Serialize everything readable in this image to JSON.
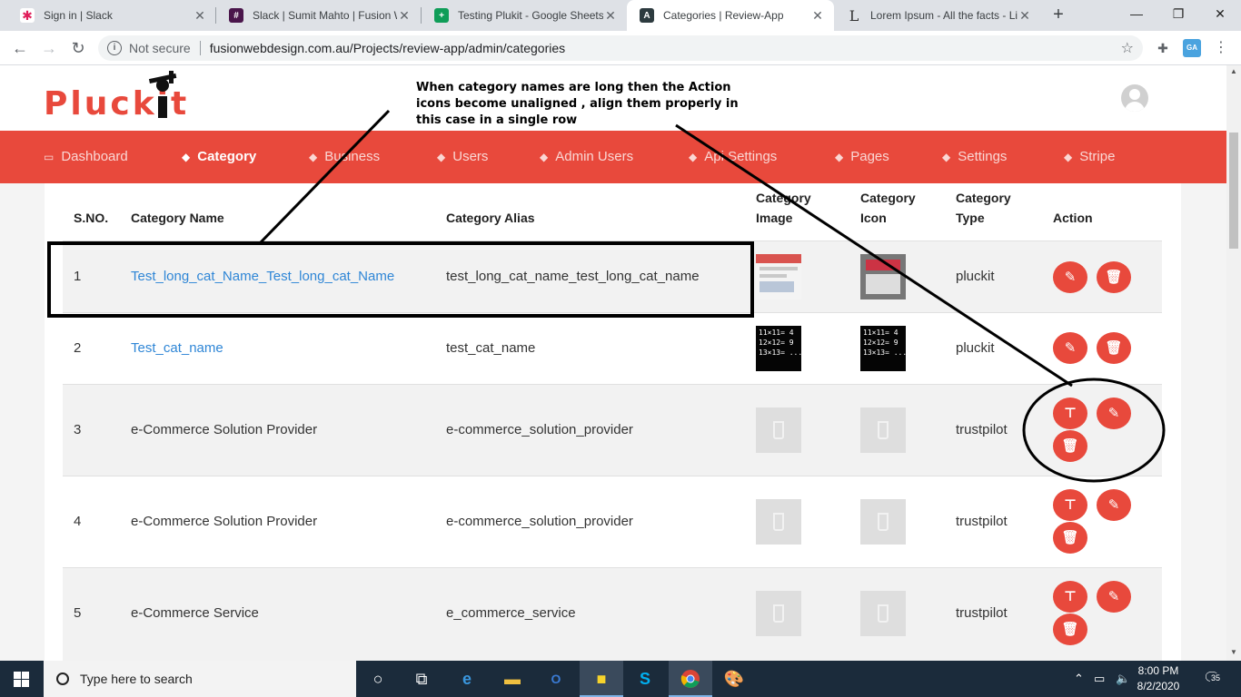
{
  "browser": {
    "tabs": [
      {
        "title": "Sign in | Slack",
        "icon": "slack-icon",
        "active": false
      },
      {
        "title": "Slack | Sumit Mahto | Fusion W",
        "icon": "slack-icon",
        "active": false
      },
      {
        "title": "Testing Plukit - Google Sheets",
        "icon": "google-sheets-icon",
        "active": false
      },
      {
        "title": "Categories | Review-App",
        "icon": "review-app-icon",
        "active": true
      },
      {
        "title": "Lorem Ipsum - All the facts - Li",
        "icon": "lorem-ipsum-icon",
        "active": false
      }
    ],
    "security_label": "Not secure",
    "url": "fusionwebdesign.com.au/Projects/review-app/admin/categories",
    "extension_badge": "GA"
  },
  "header": {
    "logo_text": "Pluckit",
    "annotation": "When category names are long then the Action icons become unaligned , align them properly in this case in a single row"
  },
  "nav": {
    "items": [
      {
        "label": "Dashboard",
        "icon": "monitor-icon",
        "active": false
      },
      {
        "label": "Category",
        "icon": "layers-icon",
        "active": true
      },
      {
        "label": "Business",
        "icon": "layers-icon",
        "active": false
      },
      {
        "label": "Users",
        "icon": "layers-icon",
        "active": false
      },
      {
        "label": "Admin Users",
        "icon": "layers-icon",
        "active": false
      },
      {
        "label": "Api Settings",
        "icon": "layers-icon",
        "active": false
      },
      {
        "label": "Pages",
        "icon": "layers-icon",
        "active": false
      },
      {
        "label": "Settings",
        "icon": "layers-icon",
        "active": false
      },
      {
        "label": "Stripe",
        "icon": "layers-icon",
        "active": false
      }
    ]
  },
  "table": {
    "headers": {
      "sno": "S.NO.",
      "name": "Category Name",
      "alias": "Category Alias",
      "image_1": "Category",
      "image_2": "Image",
      "icon_1": "Category",
      "icon_2": "Icon",
      "type_1": "Category",
      "type_2": "Type",
      "action": "Action"
    },
    "rows": [
      {
        "sno": "1",
        "name": "Test_long_cat_Name_Test_long_cat_Name",
        "alias": "test_long_cat_name_test_long_cat_name",
        "type": "pluckit",
        "image": "screenshot",
        "icon": "screenshot",
        "actions": [
          "edit",
          "delete"
        ]
      },
      {
        "sno": "2",
        "name": "Test_cat_name",
        "alias": "test_cat_name",
        "type": "pluckit",
        "image": "math",
        "icon": "math",
        "actions": [
          "edit",
          "delete"
        ]
      },
      {
        "sno": "3",
        "name": "e-Commerce Solution Provider",
        "alias": "e-commerce_solution_provider",
        "type": "trustpilot",
        "image": "placeholder",
        "icon": "placeholder",
        "actions": [
          "signpost",
          "edit",
          "delete"
        ]
      },
      {
        "sno": "4",
        "name": "e-Commerce Solution Provider",
        "alias": "e-commerce_solution_provider",
        "type": "trustpilot",
        "image": "placeholder",
        "icon": "placeholder",
        "actions": [
          "signpost",
          "edit",
          "delete"
        ]
      },
      {
        "sno": "5",
        "name": "e-Commerce Service",
        "alias": "e_commerce_service",
        "type": "trustpilot",
        "image": "placeholder",
        "icon": "placeholder",
        "actions": [
          "signpost",
          "edit",
          "delete"
        ]
      }
    ],
    "math_thumb_text": "11×11= 4\n12×12= 9\n13×13= ...?"
  },
  "taskbar": {
    "search_placeholder": "Type here to search",
    "time": "8:00 PM",
    "date": "8/2/2020",
    "notification_count": "35"
  },
  "colors": {
    "brand_red": "#e8493c",
    "link_blue": "#2f86d6",
    "taskbar": "#1b2b3b"
  }
}
